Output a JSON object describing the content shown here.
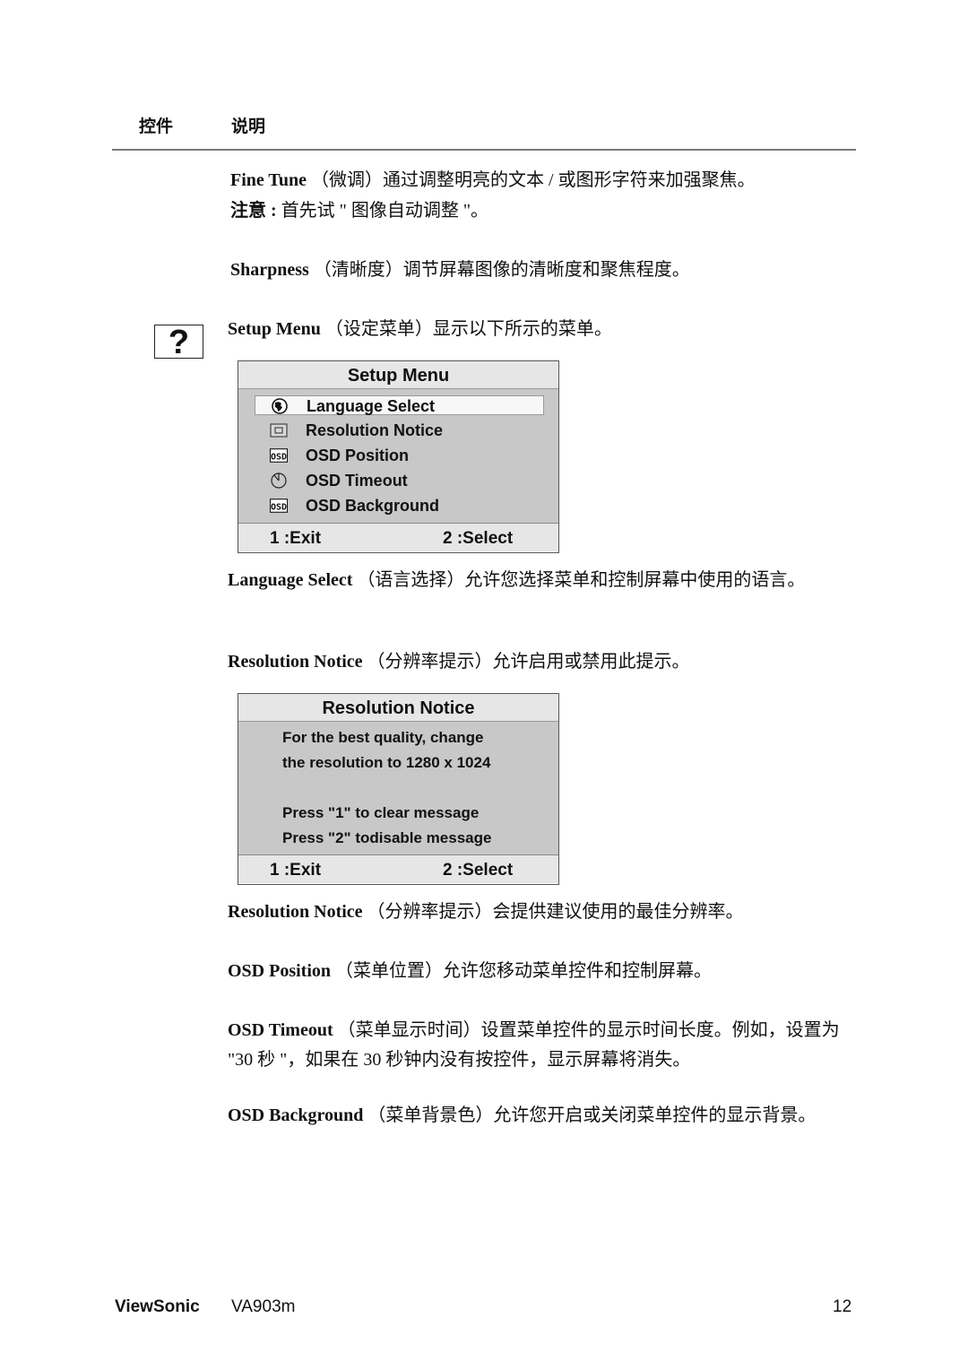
{
  "header": {
    "col_control": "控件",
    "col_description": "说明"
  },
  "paragraphs": {
    "fine_tune": {
      "term": "Fine Tune",
      "text": " （微调）通过调整明亮的文本 / 或图形字符来加强聚焦。"
    },
    "fine_tune_note": {
      "term": "注意 :",
      "text": " 首先试 \" 图像自动调整 \"。"
    },
    "sharpness": {
      "term": "Sharpness",
      "text": " （清晰度）调节屏幕图像的清晰度和聚焦程度。"
    },
    "setup_menu": {
      "term": "Setup Menu",
      "text": " （设定菜单）显示以下所示的菜单。"
    },
    "language_select": {
      "term": "Language Select",
      "text": " （语言选择）允许您选择菜单和控制屏幕中使用的语言。"
    },
    "resolution_notice_1": {
      "term": "Resolution Notice",
      "text": " （分辨率提示）允许启用或禁用此提示。"
    },
    "resolution_notice_2": {
      "term": "Resolution Notice",
      "text": " （分辨率提示）会提供建议使用的最佳分辨率。"
    },
    "osd_position": {
      "term": "OSD Position",
      "text": " （菜单位置）允许您移动菜单控件和控制屏幕。"
    },
    "osd_timeout": {
      "term": "OSD Timeout",
      "text": " （菜单显示时间）设置菜单控件的显示时间长度。例如，设置为 \"30 秒 \"，如果在 30 秒钟内没有按控件，显示屏幕将消失。"
    },
    "osd_background": {
      "term": "OSD Background",
      "text": " （菜单背景色）允许您开启或关闭菜单控件的显示背景。"
    }
  },
  "setup_icon": {
    "glyph": "?",
    "name": "question-mark-icon"
  },
  "setup_menu_osd": {
    "title": "Setup Menu",
    "items": [
      {
        "label": "Language Select",
        "icon": "globe-icon",
        "selected": true
      },
      {
        "label": "Resolution Notice",
        "icon": "monitor-icon",
        "selected": false
      },
      {
        "label": "OSD Position",
        "icon": "osd-icon",
        "selected": false
      },
      {
        "label": "OSD Timeout",
        "icon": "clock-icon",
        "selected": false
      },
      {
        "label": "OSD Background",
        "icon": "osd-icon",
        "selected": false
      }
    ],
    "footer_left": "1 :Exit",
    "footer_right": "2 :Select"
  },
  "resolution_notice_osd": {
    "title": "Resolution Notice",
    "lines": [
      "For the best quality, change",
      "the resolution to 1280 x 1024",
      "",
      "Press \"1\" to clear message",
      "Press \"2\" todisable message"
    ],
    "footer_left": "1 :Exit",
    "footer_right": "2 :Select"
  },
  "footer": {
    "brand": "ViewSonic",
    "model": "VA903m",
    "page_number": "12"
  }
}
